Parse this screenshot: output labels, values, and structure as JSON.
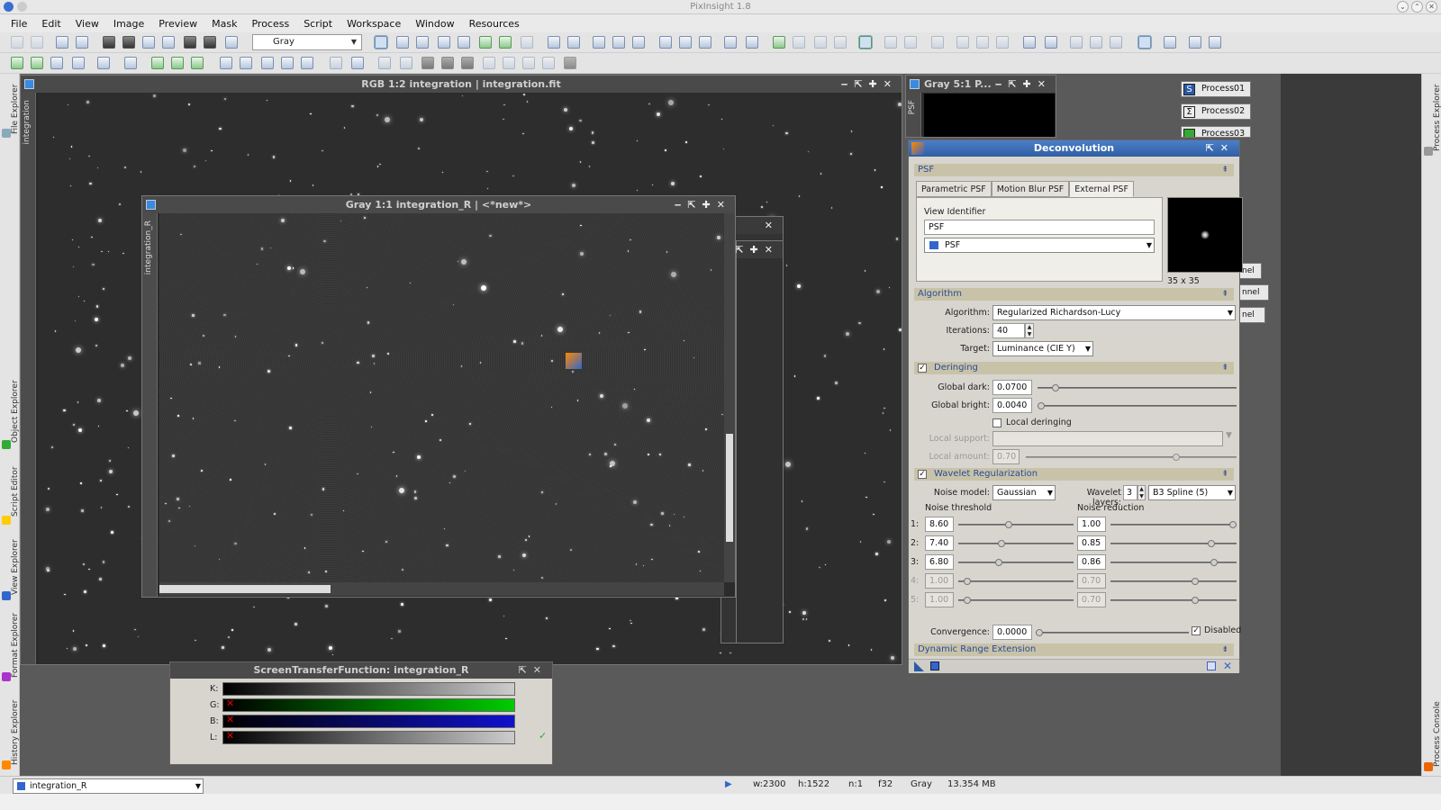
{
  "app": {
    "title": "PixInsight 1.8"
  },
  "menu": [
    "File",
    "Edit",
    "View",
    "Image",
    "Preview",
    "Mask",
    "Process",
    "Script",
    "Workspace",
    "Window",
    "Resources"
  ],
  "toolbar": {
    "channel_combo": "Gray"
  },
  "left_sidebar": [
    "File Explorer",
    "Object Explorer",
    "Script Editor",
    "View Explorer",
    "Format Explorer",
    "History Explorer"
  ],
  "right_sidebar": [
    "Process Explorer",
    "Process Console"
  ],
  "windows": {
    "main": {
      "title": "RGB 1:2 integration | integration.fit",
      "side": "integration"
    },
    "gray": {
      "title": "Gray 1:1 integration_R | <*new*>",
      "side": "integration_R"
    },
    "psf": {
      "title": "Gray 5:1 P...",
      "side": "PSF"
    }
  },
  "process_icons": [
    "Process01",
    "Process02",
    "Process03",
    "nel",
    "nnel",
    "nel"
  ],
  "deconv": {
    "title": "Deconvolution",
    "psf_section": "PSF",
    "tabs": [
      "Parametric PSF",
      "Motion Blur PSF",
      "External PSF"
    ],
    "view_identifier_label": "View Identifier",
    "view_identifier": "PSF",
    "view_select": "PSF",
    "psf_size": "35 x 35",
    "algorithm_section": "Algorithm",
    "algorithm_label": "Algorithm:",
    "algorithm": "Regularized Richardson-Lucy",
    "iterations_label": "Iterations:",
    "iterations": "40",
    "target_label": "Target:",
    "target": "Luminance (CIE Y)",
    "deringing_section": "Deringing",
    "global_dark_label": "Global dark:",
    "global_dark": "0.0700",
    "global_bright_label": "Global bright:",
    "global_bright": "0.0040",
    "local_deringing": "Local deringing",
    "local_support_label": "Local support:",
    "local_amount_label": "Local amount:",
    "local_amount": "0.70",
    "wavelet_section": "Wavelet Regularization",
    "noise_model_label": "Noise model:",
    "noise_model": "Gaussian",
    "wavelet_layers_label": "Wavelet layers:",
    "wavelet_layers": "3",
    "wavelet_func": "B3 Spline (5)",
    "noise_threshold_label": "Noise threshold",
    "noise_reduction_label": "Noise reduction",
    "layers": [
      {
        "n": "1:",
        "t": "8.60",
        "r": "1.00",
        "tv": 0.43,
        "rv": 1.0,
        "on": true
      },
      {
        "n": "2:",
        "t": "7.40",
        "r": "0.85",
        "tv": 0.37,
        "rv": 0.82,
        "on": true
      },
      {
        "n": "3:",
        "t": "6.80",
        "r": "0.86",
        "tv": 0.34,
        "rv": 0.84,
        "on": true
      },
      {
        "n": "4:",
        "t": "1.00",
        "r": "0.70",
        "tv": 0.05,
        "rv": 0.68,
        "on": false
      },
      {
        "n": "5:",
        "t": "1.00",
        "r": "0.70",
        "tv": 0.05,
        "rv": 0.68,
        "on": false
      }
    ],
    "convergence_label": "Convergence:",
    "convergence": "0.0000",
    "disabled_label": "Disabled",
    "dre_section": "Dynamic Range Extension"
  },
  "stf": {
    "title": "ScreenTransferFunction: integration_R",
    "rows": [
      "K:",
      "G:",
      "B:",
      "L:"
    ]
  },
  "status": {
    "view": "integration_R",
    "w": "w:2300",
    "h": "h:1522",
    "n": "n:1",
    "f": "f32",
    "mode": "Gray",
    "size": "13.354 MB"
  }
}
